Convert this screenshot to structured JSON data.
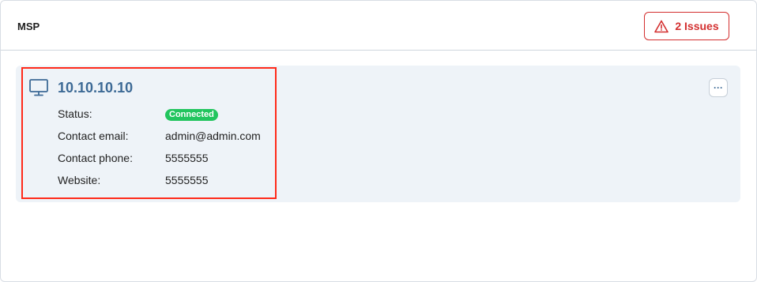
{
  "header": {
    "title": "MSP",
    "issues_label": "2 Issues",
    "issues_icon": "warning-triangle-icon",
    "issues_color": "#d32f2f"
  },
  "device": {
    "icon": "monitor-icon",
    "name": "10.10.10.10",
    "menu_icon": "more-horizontal-icon",
    "fields": {
      "status_label": "Status:",
      "status_value": "Connected",
      "status_color": "#22c55e",
      "email_label": "Contact email:",
      "email_value": "admin@admin.com",
      "phone_label": "Contact phone:",
      "phone_value": "5555555",
      "website_label": "Website:",
      "website_value": "5555555"
    }
  },
  "highlight_color": "#ff2a1a"
}
